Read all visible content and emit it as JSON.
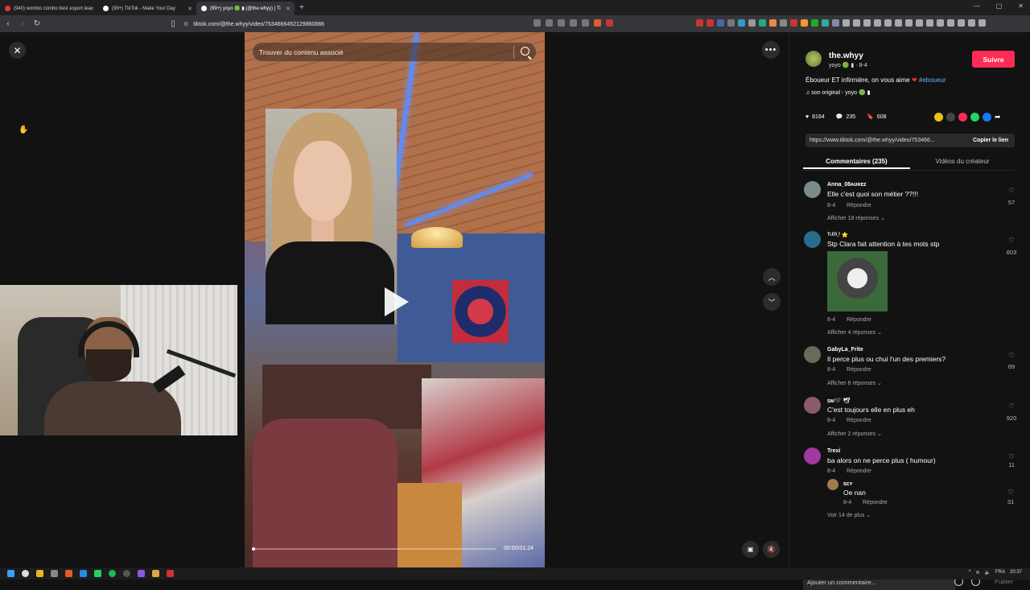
{
  "browser": {
    "tabs": [
      {
        "title": "(940) wombo combo best esport lea",
        "color": "#e33"
      },
      {
        "title": "(99+) TikTok - Make Your Day",
        "color": "#fff"
      },
      {
        "title": "(99+) yoyo 🟢 ▮ (@the.whyy) | Ti",
        "color": "#fff"
      }
    ],
    "new_tab": "+",
    "url": "tiktok.com/@the.whyy/video/7534666452129860886",
    "window_controls": [
      "—",
      "▢",
      "✕"
    ]
  },
  "video": {
    "search_placeholder": "Trouver du contenu associé",
    "time": "00:00/01:24",
    "progress": 0.0
  },
  "author": {
    "username": "the.whyy",
    "nickname_date": "yoyo 🟢 ▮ · 8-4",
    "follow_label": "Suivre"
  },
  "post": {
    "caption": "Éboueur ET infirmière, on vous aime",
    "hashtag": "#eboueur",
    "music": "son original - yoyo 🟢 ▮"
  },
  "stats": {
    "likes": "8164",
    "comments": "235",
    "saves": "608"
  },
  "share_link": {
    "url": "https://www.tiktok.com/@the.whyy/video/753466...",
    "copy_label": "Copier le lien"
  },
  "panel_tabs": {
    "comments": "Commentaires (235)",
    "creator_videos": "Vidéos du créateur"
  },
  "comments": [
    {
      "name": "Anna_08ᴀᴜʀᴇᴢ",
      "text": "Elle c'est quoi son métier ??!!!",
      "date": "8-4",
      "reply": "Répondre",
      "likes": "57",
      "more": "Afficher 18 réponses ⌄",
      "avatar": "#7b8a8a"
    },
    {
      "name": "ᵀᴸᴱᴼ.ᶠ ⭐",
      "text": "Stp Clara fait attention à tes mots stp",
      "date": "8-4",
      "reply": "Répondre",
      "likes": "603",
      "more": "Afficher 4 réponses ⌄",
      "avatar": "#2a6a8a"
    },
    {
      "name": "GabyLa_Frite",
      "text": "Il perce plus ou chui l'un des premiers?",
      "date": "8-4",
      "reply": "Répondre",
      "likes": "69",
      "more": "Afficher 8 réponses ⌄",
      "avatar": "#6a6a5a"
    },
    {
      "name": "ꜱᴍ🖤 🕊",
      "text": "C'est toujours elle en plus eh",
      "date": "8-4",
      "reply": "Répondre",
      "likes": "920",
      "more": "Afficher 2 réponses ⌄",
      "avatar": "#8a5a6a"
    },
    {
      "name": "Trexi",
      "text": "ba alors on ne perce plus ( humour)",
      "date": "8-4",
      "reply": "Répondre",
      "likes": "11",
      "more": "",
      "avatar": "#a03aa0"
    }
  ],
  "sub_reply": {
    "name": "ꜱᴄʏ",
    "text": "Oe nan",
    "date": "8-4",
    "reply": "Répondre",
    "likes": "31",
    "more": "Voir 14 de plus ⌄"
  },
  "comment_input": {
    "placeholder": "Ajouter un commentaire...",
    "publish": "Publier"
  },
  "taskbar": {
    "lang": "FRA",
    "clock": "20:37"
  }
}
